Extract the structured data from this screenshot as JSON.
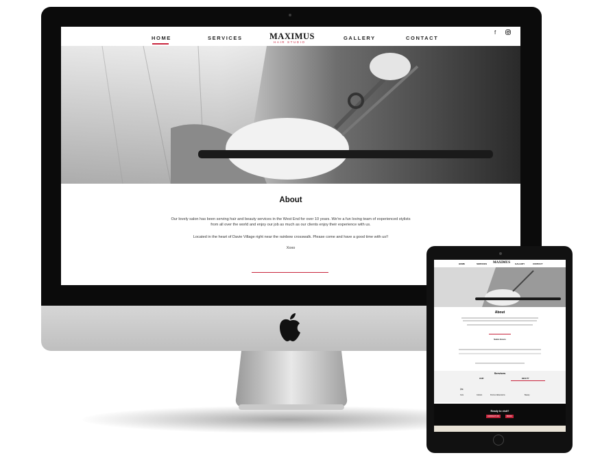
{
  "nav": {
    "items": [
      {
        "label": "HOME",
        "active": true
      },
      {
        "label": "SERVICES",
        "active": false
      },
      {
        "label": "GALLERY",
        "active": false
      },
      {
        "label": "CONTACT",
        "active": false
      }
    ],
    "social_icons": [
      "facebook-icon",
      "instagram-icon"
    ]
  },
  "logo": {
    "main": "MAXIMUS",
    "sub": "HAIR STUDIO"
  },
  "about": {
    "title": "About",
    "para1": "Our lovely salon has been serving hair and beauty services in the West End for over 10 years. We're a fun loving team of experienced stylists from all over the world and enjoy our job as much as our clients enjoy their experience with us.",
    "para2": "Located in the heart of Davie Village right near the rainbow crosswalk. Please come and have a good time with us!!",
    "signoff": "Xoxo"
  },
  "tablet": {
    "nav": [
      "HOME",
      "SERVICES",
      "GALLERY",
      "CONTACT"
    ],
    "logo": "MAXIMUS",
    "about_title": "About",
    "hours_title": "Salon Hours",
    "services_title": "Services",
    "service_tabs": [
      "HAIR",
      "BEAUTY"
    ],
    "service_items": [
      "Cuts",
      "Colours",
      "Perms & Extensions",
      "Beauty"
    ],
    "cta_title": "Ready to visit?",
    "cta_buttons": [
      "CONTACT US",
      "BOOK"
    ]
  },
  "colors": {
    "accent": "#c8243c",
    "text": "#222222",
    "bezel": "#0b0b0b"
  }
}
